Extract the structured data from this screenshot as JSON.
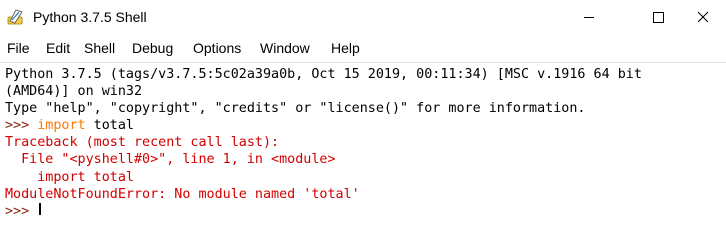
{
  "window": {
    "title": "Python 3.7.5 Shell",
    "icon": "python-feather-icon"
  },
  "controls": {
    "minimize_icon": "minimize-icon",
    "maximize_icon": "maximize-icon",
    "close_icon": "close-icon"
  },
  "menu": {
    "items": [
      {
        "label": "File"
      },
      {
        "label": "Edit"
      },
      {
        "label": "Shell"
      },
      {
        "label": "Debug"
      },
      {
        "label": "Options"
      },
      {
        "label": "Window"
      },
      {
        "label": "Help"
      }
    ]
  },
  "shell": {
    "banner_1": "Python 3.7.5 (tags/v3.7.5:5c02a39a0b, Oct 15 2019, 00:11:34) [MSC v.1916 64 bit",
    "banner_2": "(AMD64)] on win32",
    "banner_3": "Type \"help\", \"copyright\", \"credits\" or \"license()\" for more information.",
    "prompt": ">>> ",
    "cmd_keyword": "import",
    "cmd_rest": " total",
    "traceback_1": "Traceback (most recent call last):",
    "traceback_2": "  File \"<pyshell#0>\", line 1, in <module>",
    "traceback_3": "    import total",
    "error": "ModuleNotFoundError: No module named 'total'",
    "prompt_2": ">>> "
  },
  "colors": {
    "stdout": "#000000",
    "stderr": "#d20000",
    "prompt": "#8a1f11",
    "keyword": "#ff7700"
  }
}
